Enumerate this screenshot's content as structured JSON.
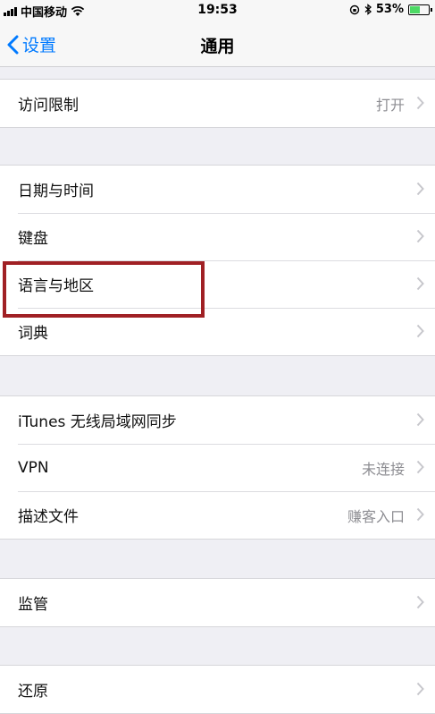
{
  "status_bar": {
    "carrier": "中国移动",
    "time": "19:53",
    "battery": "53%",
    "battery_level": 0.53
  },
  "nav": {
    "back_label": "设置",
    "title": "通用"
  },
  "groups": [
    {
      "rows": [
        {
          "label": "访问限制",
          "value": "打开"
        }
      ]
    },
    {
      "rows": [
        {
          "label": "日期与时间",
          "value": ""
        },
        {
          "label": "键盘",
          "value": ""
        },
        {
          "label": "语言与地区",
          "value": ""
        },
        {
          "label": "词典",
          "value": ""
        }
      ]
    },
    {
      "rows": [
        {
          "label": "iTunes 无线局域网同步",
          "value": ""
        },
        {
          "label": "VPN",
          "value": "未连接"
        },
        {
          "label": "描述文件",
          "value": "赚客入口"
        }
      ]
    },
    {
      "rows": [
        {
          "label": "监管",
          "value": ""
        }
      ]
    },
    {
      "rows": [
        {
          "label": "还原",
          "value": ""
        }
      ]
    }
  ],
  "colors": {
    "accent": "#007aff",
    "highlight": "#a02024",
    "battery_fill": "#4cd964"
  }
}
